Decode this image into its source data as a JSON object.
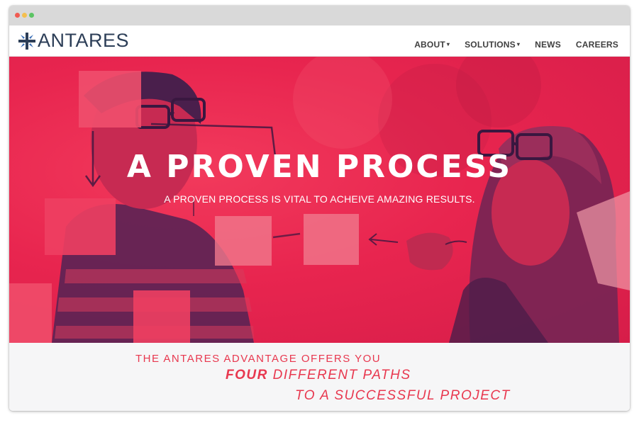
{
  "nav": {
    "brand": "ANTARES",
    "items": [
      {
        "label": "ABOUT",
        "has_dropdown": true
      },
      {
        "label": "SOLUTIONS",
        "has_dropdown": true
      },
      {
        "label": "NEWS",
        "has_dropdown": false
      },
      {
        "label": "CAREERS",
        "has_dropdown": false
      }
    ],
    "caret": "▾"
  },
  "hero": {
    "title": "A PROVEN PROCESS",
    "subtitle": "A PROVEN PROCESS IS VITAL TO ACHEIVE AMAZING RESULTS."
  },
  "advantage": {
    "line1": "THE ANTARES ADVANTAGE OFFERS YOU",
    "highlight": "FOUR",
    "line2_rest": " DIFFERENT PATHS",
    "line3": "TO A SUCCESSFUL PROJECT"
  },
  "colors": {
    "brand_navy": "#2c3e57",
    "hero_red": "#e8254f",
    "accent_red": "#e8384f"
  },
  "icons": {
    "logo": "compass-star-logo-icon",
    "window_dots": [
      "close-dot",
      "minimize-dot",
      "maximize-dot"
    ]
  }
}
